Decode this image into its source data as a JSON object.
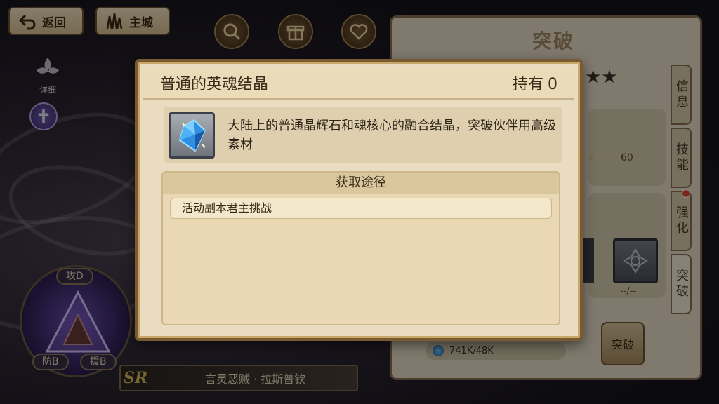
{
  "nav": {
    "back_label": "返回",
    "city_label": "主城"
  },
  "left": {
    "detail_label": "详细",
    "tags": {
      "attack": "攻D",
      "defense": "防B",
      "support": "援B"
    },
    "rarity": "SR",
    "character_name": "言灵恶贼 · 拉斯普钦"
  },
  "top_icons": [
    "search-icon",
    "gift-icon",
    "heart-icon"
  ],
  "right_panel": {
    "title": "突破",
    "stars": "★★",
    "level_value": "60",
    "material_count": "--/--",
    "resource": "741K/48K",
    "breakthrough_label": "突破",
    "tabs": [
      {
        "label": "信息",
        "badge": false
      },
      {
        "label": "技能",
        "badge": false
      },
      {
        "label": "强化",
        "badge": true
      },
      {
        "label": "突破",
        "badge": false,
        "active": true
      }
    ]
  },
  "modal": {
    "title": "普通的英魂结晶",
    "hold_label": "持有",
    "hold_count": "0",
    "description": "大陆上的普通晶辉石和魂核心的融合结晶，突破伙伴用高级素材",
    "source_header": "获取途径",
    "sources": [
      "活动副本君主挑战"
    ]
  },
  "colors": {
    "modal_border": "#7a5a30",
    "parchment": "#e9dcc0",
    "badge_red": "#e04a2a"
  }
}
